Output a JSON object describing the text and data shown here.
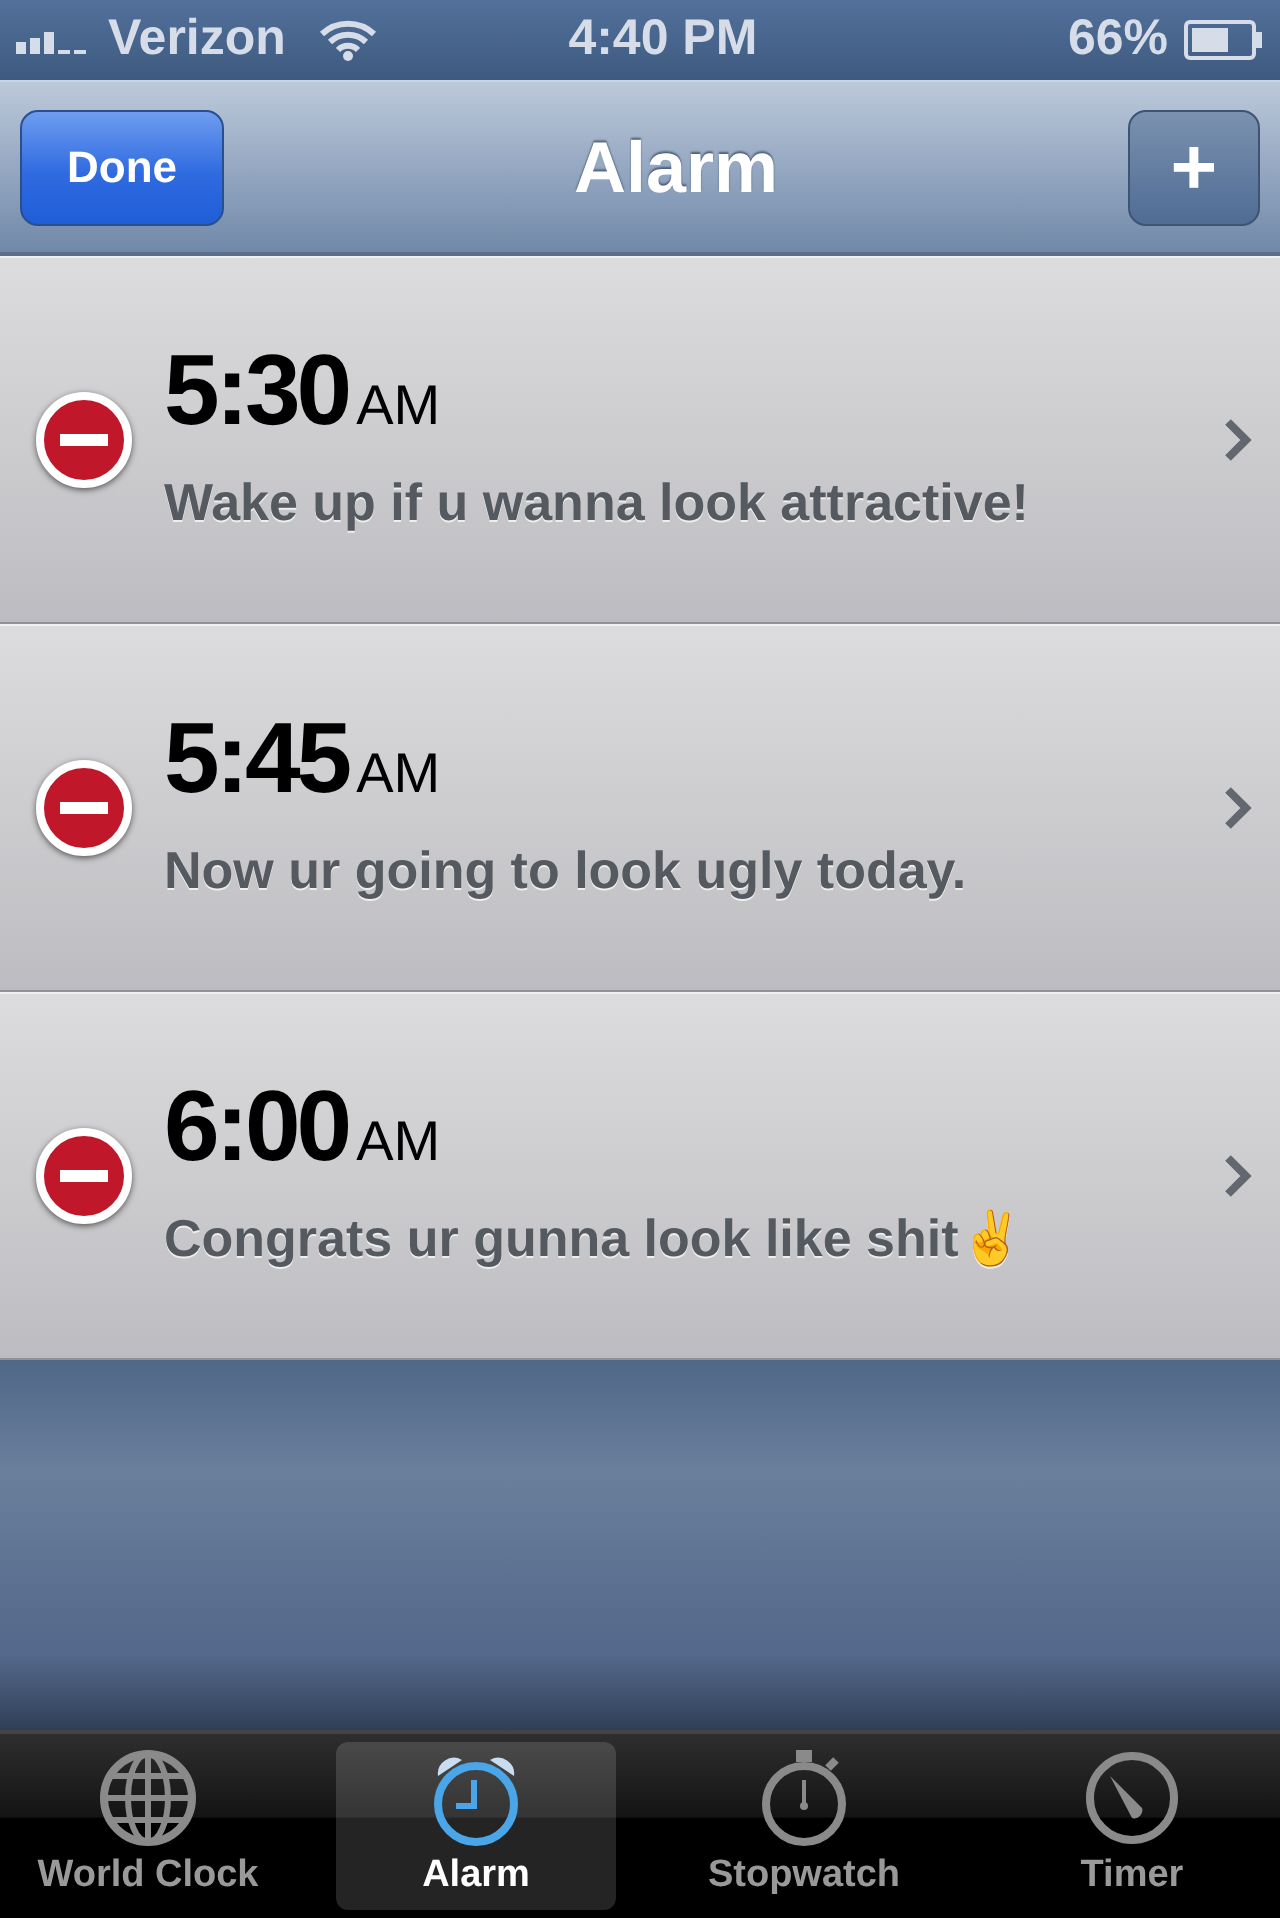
{
  "status_bar": {
    "carrier": "Verizon",
    "time": "4:40 PM",
    "battery": "66%"
  },
  "nav_bar": {
    "left_button": "Done",
    "title": "Alarm",
    "right_button": "+"
  },
  "alarms": [
    {
      "time": "5:30",
      "period": "AM",
      "label": "Wake up if u wanna look attractive!"
    },
    {
      "time": "5:45",
      "period": "AM",
      "label": "Now ur going to look ugly today."
    },
    {
      "time": "6:00",
      "period": "AM",
      "label": "Congrats ur gunna look like shit✌"
    }
  ],
  "tabs": [
    {
      "label": "World Clock",
      "kind": "globe",
      "selected": false
    },
    {
      "label": "Alarm",
      "kind": "alarm",
      "selected": true
    },
    {
      "label": "Stopwatch",
      "kind": "stopwatch",
      "selected": false
    },
    {
      "label": "Timer",
      "kind": "timer",
      "selected": false
    }
  ]
}
